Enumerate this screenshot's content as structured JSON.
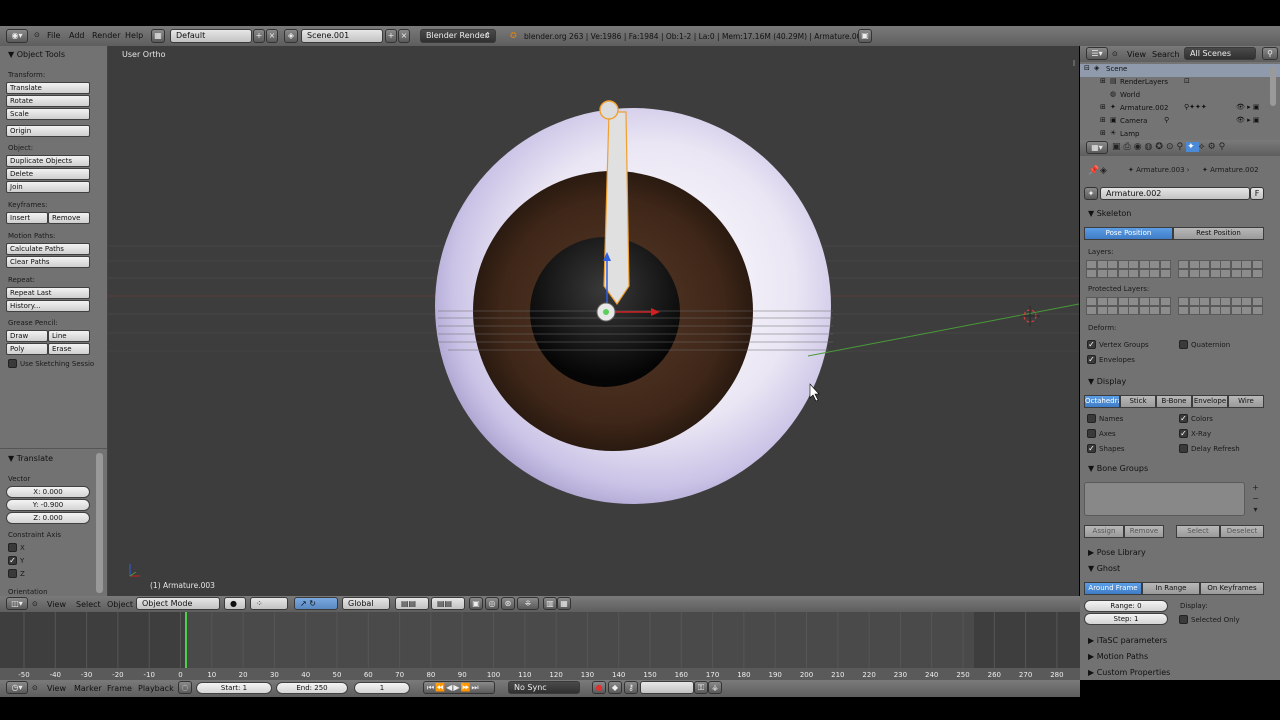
{
  "info_header": {
    "menus": [
      "File",
      "Add",
      "Render",
      "Help"
    ],
    "screen_layout": "Default",
    "scene": "Scene.001",
    "render_engine": "Blender Render",
    "status": "blender.org 263 | Ve:1986 | Fa:1984 | Ob:1-2 | La:0 | Mem:17.16M (40.29M) | Armature.003"
  },
  "tool_shelf": {
    "title": "Object Tools",
    "transform_label": "Transform:",
    "translate": "Translate",
    "rotate": "Rotate",
    "scale": "Scale",
    "origin": "Origin",
    "object_label": "Object:",
    "duplicate": "Duplicate Objects",
    "delete": "Delete",
    "join": "Join",
    "keyframes_label": "Keyframes:",
    "insert": "Insert",
    "remove": "Remove",
    "motion_paths_label": "Motion Paths:",
    "calc_paths": "Calculate Paths",
    "clear_paths": "Clear Paths",
    "repeat_label": "Repeat:",
    "repeat_last": "Repeat Last",
    "history": "History...",
    "grease_label": "Grease Pencil:",
    "draw": "Draw",
    "line": "Line",
    "poly": "Poly",
    "erase": "Erase",
    "sketching": "Use Sketching Sessio",
    "op_title": "Translate",
    "vector_label": "Vector",
    "x": "X: 0.000",
    "y": "Y: -0.900",
    "z": "Z: 0.000",
    "constraint_label": "Constraint Axis",
    "ax_x": "X",
    "ax_y": "Y",
    "ax_z": "Z",
    "orientation_label": "Orientation"
  },
  "viewport": {
    "view_name": "User Ortho",
    "object_name": "(1) Armature.003"
  },
  "view_header": {
    "menus": [
      "View",
      "Select",
      "Object"
    ],
    "mode": "Object Mode",
    "orientation": "Global"
  },
  "timeline": {
    "ticks": [
      "-50",
      "-40",
      "-30",
      "-20",
      "-10",
      "0",
      "10",
      "20",
      "30",
      "40",
      "50",
      "60",
      "70",
      "80",
      "90",
      "100",
      "110",
      "120",
      "130",
      "140",
      "150",
      "160",
      "170",
      "180",
      "190",
      "200",
      "210",
      "220",
      "230",
      "240",
      "250",
      "260",
      "270",
      "280"
    ],
    "current_frame": 0
  },
  "timeline_header": {
    "menus": [
      "View",
      "Marker",
      "Frame",
      "Playback"
    ],
    "start": "Start: 1",
    "end": "End: 250",
    "frame": "1",
    "sync": "No Sync"
  },
  "outliner": {
    "menus": [
      "View",
      "Search"
    ],
    "filter": "All Scenes",
    "rows": [
      "Scene",
      "RenderLayers",
      "World",
      "Armature.002",
      "Camera",
      "Lamp"
    ]
  },
  "properties": {
    "breadcrumb_a": "Armature.003",
    "breadcrumb_b": "Armature.002",
    "datablock": "Armature.002",
    "fake_user": "F",
    "skeleton_title": "Skeleton",
    "pose_position": "Pose Position",
    "rest_position": "Rest Position",
    "layers_label": "Layers:",
    "protected_label": "Protected Layers:",
    "deform_label": "Deform:",
    "vertex_groups": "Vertex Groups",
    "quaternion": "Quaternion",
    "envelopes": "Envelopes",
    "display_title": "Display",
    "disp_tabs": [
      "Octahedral",
      "Stick",
      "B-Bone",
      "Envelope",
      "Wire"
    ],
    "names": "Names",
    "colors": "Colors",
    "axes": "Axes",
    "xray": "X-Ray",
    "shapes": "Shapes",
    "delay_refresh": "Delay Refresh",
    "bone_groups_title": "Bone Groups",
    "assign": "Assign",
    "remove": "Remove",
    "select": "Select",
    "deselect": "Deselect",
    "pose_library": "Pose Library",
    "ghost_title": "Ghost",
    "ghost_tabs": [
      "Around Frame",
      "In Range",
      "On Keyframes"
    ],
    "range": "Range: 0",
    "step": "Step: 1",
    "display_label": "Display:",
    "selected_only": "Selected Only",
    "itasc": "iTaSC parameters",
    "motion_paths": "Motion Paths",
    "custom_props": "Custom Properties"
  },
  "colors": {
    "accent_blue": "#4a8ad6",
    "viewport_bg": "#3d3d3d",
    "panel_bg": "#727272"
  }
}
